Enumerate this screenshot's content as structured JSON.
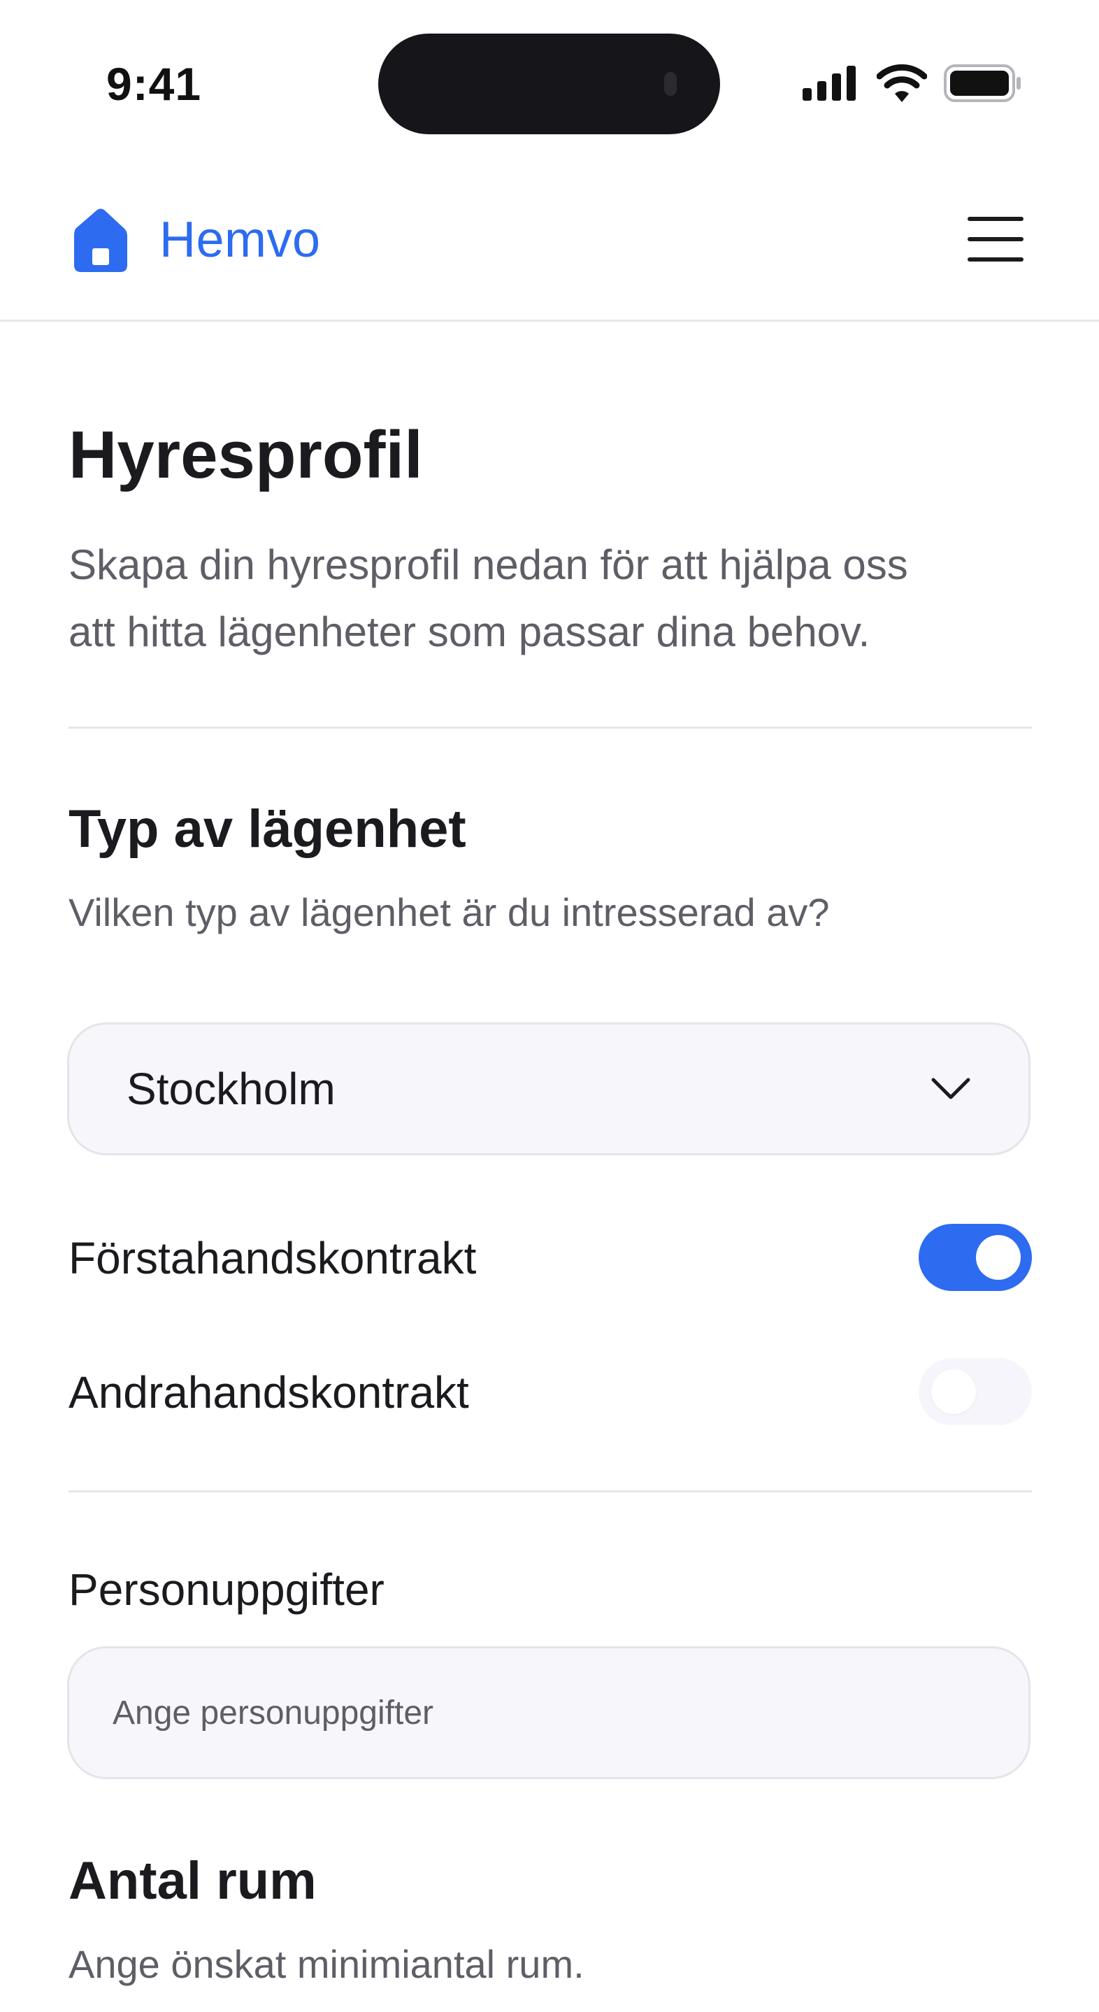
{
  "status_bar": {
    "time": "9:41"
  },
  "header": {
    "brand": "Hemvo",
    "logo_icon": "house-icon",
    "menu_icon": "hamburger-menu-icon"
  },
  "page": {
    "title": "Hyresprofil",
    "description_line1": "Skapa din hyresprofil nedan för att hjälpa oss",
    "description_line2": "att hitta lägenheter som passar dina behov."
  },
  "apartment_type": {
    "title": "Typ av lägenhet",
    "subtitle": "Vilken typ av lägenhet är du intresserad av?",
    "location_select": {
      "value": "Stockholm",
      "icon": "chevron-down-icon"
    },
    "contracts": [
      {
        "label": "Förstahandskontrakt",
        "enabled": true
      },
      {
        "label": "Andrahandskontrakt",
        "enabled": false
      }
    ]
  },
  "personal_info": {
    "label": "Personuppgifter",
    "placeholder": "Ange personuppgifter",
    "value": ""
  },
  "rooms": {
    "title": "Antal rum",
    "subtitle": "Ange önskat minimiantal rum."
  },
  "colors": {
    "accent": "#2d6bf0",
    "text_primary": "#1b1b1f",
    "text_secondary": "#5e5e66",
    "field_background": "#f7f7fb",
    "divider": "#e6e6ea"
  }
}
